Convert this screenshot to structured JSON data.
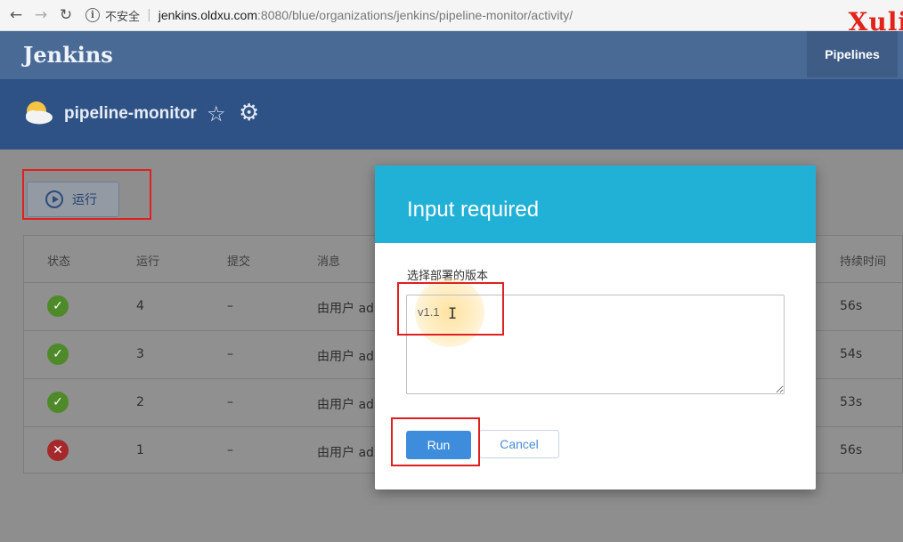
{
  "browser": {
    "back_icon": "←",
    "forward_icon": "→",
    "reload_icon": "↻",
    "info_icon": "i",
    "insecure_label": "不安全",
    "separator": "|",
    "url_host": "jenkins.oldxu.com",
    "url_rest": ":8080/blue/organizations/jenkins/pipeline-monitor/activity/"
  },
  "watermark": "Xuli",
  "header": {
    "logo": "Jenkins",
    "pipelines_tab": "Pipelines"
  },
  "pipeline": {
    "name": "pipeline-monitor",
    "star_icon": "☆",
    "gear_icon": "⚙"
  },
  "run_button_label": "运行",
  "table": {
    "headers": {
      "status": "状态",
      "run": "运行",
      "commit": "提交",
      "message": "消息",
      "duration": "持续时间"
    },
    "rows": [
      {
        "status": "success",
        "status_glyph": "✓",
        "run": "4",
        "commit": "–",
        "message": "由用户 ad",
        "duration": "56s"
      },
      {
        "status": "success",
        "status_glyph": "✓",
        "run": "3",
        "commit": "–",
        "message": "由用户 ad",
        "duration": "54s"
      },
      {
        "status": "success",
        "status_glyph": "✓",
        "run": "2",
        "commit": "–",
        "message": "由用户 ad",
        "duration": "53s"
      },
      {
        "status": "failed",
        "status_glyph": "✕",
        "run": "1",
        "commit": "–",
        "message": "由用户 ad",
        "duration": "56s"
      }
    ]
  },
  "modal": {
    "title": "Input required",
    "input_label": "选择部署的版本",
    "input_value": "v1.1",
    "text_cursor": "I",
    "run_label": "Run",
    "cancel_label": "Cancel"
  },
  "colors": {
    "header": "#4a6a96",
    "pipeline_bar": "#2e5286",
    "modal_header": "#22b1d6",
    "run_button": "#3e8ddd",
    "success": "#4e8a2a",
    "failed": "#a5282b",
    "annotation": "#e02020"
  }
}
